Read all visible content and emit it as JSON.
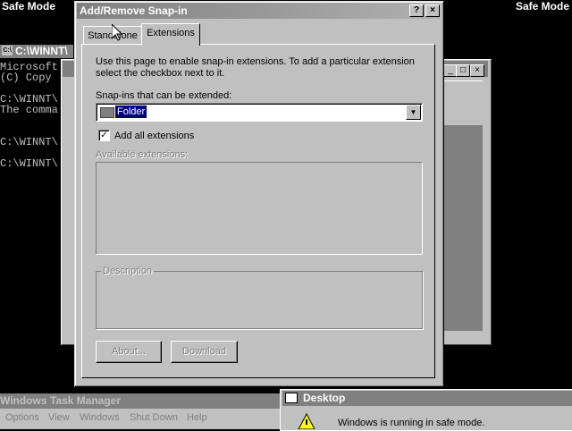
{
  "desktop": {
    "safe_mode_left": "Safe Mode",
    "safe_mode_right": "Safe Mode"
  },
  "console": {
    "title": "C:\\WINNT\\",
    "icon_text": "C:\\",
    "lines": [
      "Microsoft",
      "(C) Copy",
      "",
      "C:\\WINNT\\",
      "The comma",
      "",
      "C:\\WINNT\\",
      "",
      "C:\\WINNT\\"
    ]
  },
  "dialog": {
    "title": "Add/Remove Snap-in",
    "help_label": "?",
    "close_label": "×",
    "tabs": [
      "Standalone",
      "Extensions"
    ],
    "active_tab": "Extensions",
    "description_line1": "Use this page to enable snap-in extensions. To add a particular extension",
    "description_line2": "select the checkbox next to it.",
    "snapins_label": "Snap-ins that can be extended:",
    "snapins_selected": "Folder",
    "add_all_label": "Add all extensions",
    "add_all_checked": true,
    "available_label": "Available extensions:",
    "description_group_label": "Description",
    "about_button": "About...",
    "download_button": "Download"
  },
  "task_manager": {
    "title": "Windows Task Manager",
    "menu": [
      "Options",
      "View",
      "Windows",
      "Shut Down",
      "Help"
    ]
  },
  "message": {
    "title": "Desktop",
    "text": "Windows is running in safe mode."
  },
  "colors": {
    "desktop_bg": "#000000",
    "window_face": "#c0c0c0",
    "inactive_title": "#808080",
    "selection": "#000080"
  }
}
